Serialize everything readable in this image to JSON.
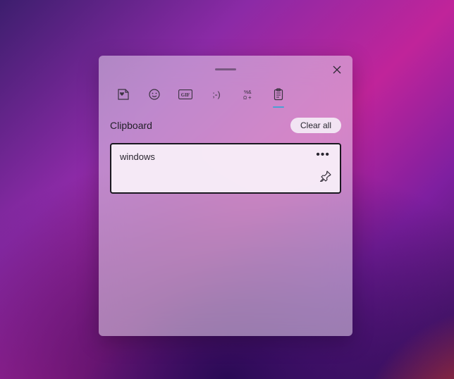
{
  "panel": {
    "title": "Clipboard",
    "clear_all_label": "Clear all"
  },
  "tabs": {
    "recent": "recent",
    "emoji": "emoji",
    "gif": "GIF",
    "kaomoji": ";-)",
    "symbols": "symbols",
    "clipboard": "clipboard",
    "active": "clipboard"
  },
  "clipboard": {
    "items": [
      {
        "text": "windows",
        "pinned": false
      }
    ]
  }
}
